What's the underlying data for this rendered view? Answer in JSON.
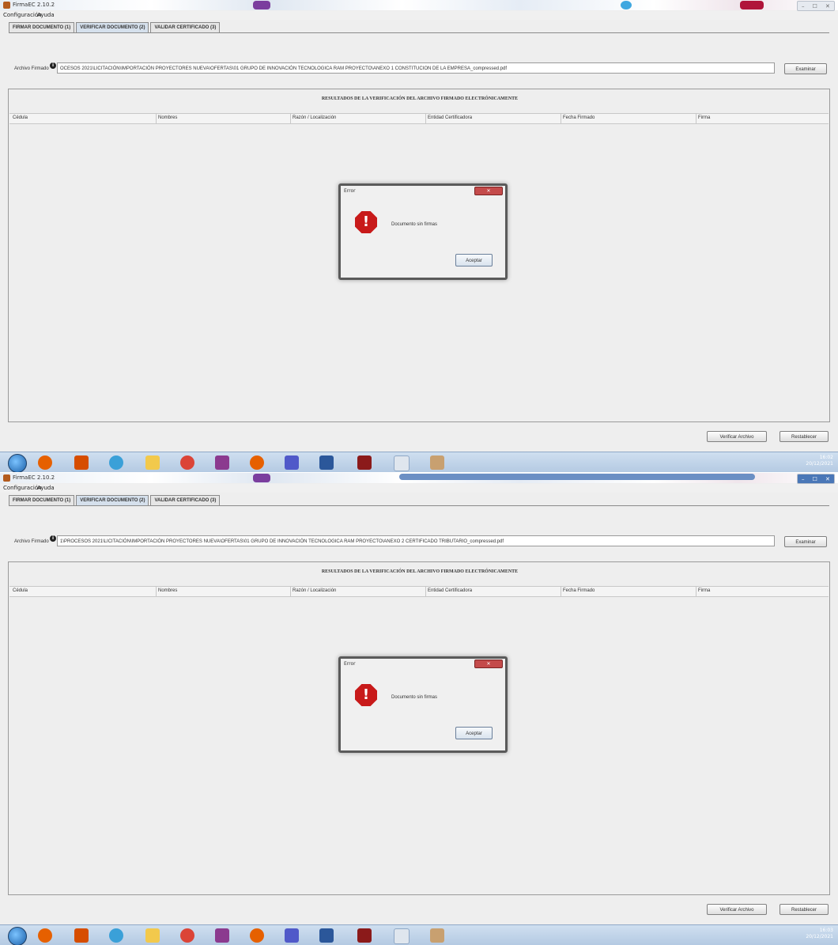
{
  "screenshots": [
    {
      "window_title": "FirmaEC 2.10.2",
      "menu": [
        "Configuración",
        "Ayuda"
      ],
      "tabs": [
        "FIRMAR DOCUMENTO (1)",
        "VERIFICAR DOCUMENTO (2)",
        "VALIDAR CERTIFICADO (3)"
      ],
      "active_tab": 1,
      "file_label": "Archivo Firmado",
      "file_path": "OCESOS 2021\\LICITACIÓN\\IMPORTACIÓN PROYECTORES NUEVA\\OFERTAS\\01 GRUPO DE INNOVACIÓN TECNOLOGICA RAM PROYECTO\\ANEXO 1 CONSTITUCION DE LA EMPRESA_compressed.pdf",
      "examine_button": "Examinar",
      "results_title": "RESULTADOS DE LA VERIFICACIÓN DEL ARCHIVO FIRMADO ELECTRÓNICAMENTE",
      "columns": [
        "Cédula",
        "Nombres",
        "Razón / Localización",
        "Entidad Certificadora",
        "Fecha Firmado",
        "Firma"
      ],
      "dialog": {
        "title": "Error",
        "close": "✕",
        "message": "Documento sin firmas",
        "ok_button": "Aceptar"
      },
      "verify_button": "Verificar Archivo",
      "reset_button": "Restablecer",
      "clock": {
        "time": "16:02",
        "date": "20/12/2021"
      }
    },
    {
      "window_title": "FirmaEC 2.10.2",
      "menu": [
        "Configuración",
        "Ayuda"
      ],
      "tabs": [
        "FIRMAR DOCUMENTO (1)",
        "VERIFICAR DOCUMENTO (2)",
        "VALIDAR CERTIFICADO (3)"
      ],
      "active_tab": 1,
      "file_label": "Archivo Firmado",
      "file_path": "1\\PROCESOS 2021\\LICITACIÓN\\IMPORTACIÓN PROYECTORES NUEVA\\OFERTAS\\01 GRUPO DE INNOVACIÓN TECNOLOGICA RAM PROYECTO\\ANEXO 2 CERTIFICADO TRIBUTARIO_compressed.pdf",
      "examine_button": "Examinar",
      "results_title": "RESULTADOS DE LA VERIFICACIÓN DEL ARCHIVO FIRMADO ELECTRÓNICAMENTE",
      "columns": [
        "Cédula",
        "Nombres",
        "Razón / Localización",
        "Entidad Certificadora",
        "Fecha Firmado",
        "Firma"
      ],
      "dialog": {
        "title": "Error",
        "close": "✕",
        "message": "Documento sin firmas",
        "ok_button": "Aceptar"
      },
      "verify_button": "Verificar Archivo",
      "reset_button": "Restablecer",
      "clock": {
        "time": "16:03",
        "date": "20/12/2021"
      }
    }
  ],
  "window_controls": [
    "–",
    "☐",
    "✕"
  ],
  "taskbar_icons": [
    "windows-start-icon",
    "firefox-icon",
    "media-player-icon",
    "browser-icon",
    "folder-icon",
    "chrome-icon",
    "app-g-icon",
    "firefox-icon",
    "teams-icon",
    "word-icon",
    "winrar-icon",
    "document-icon",
    "java-icon"
  ],
  "taskbar_colors": [
    "#1a5fa8",
    "#e66000",
    "#d64d00",
    "#3aa0d8",
    "#f2c94c",
    "#db4437",
    "#8b3a8f",
    "#e66000",
    "#5059c9",
    "#2b579a",
    "#8b1a1a",
    "#dfe6ee",
    "#c8a070"
  ]
}
